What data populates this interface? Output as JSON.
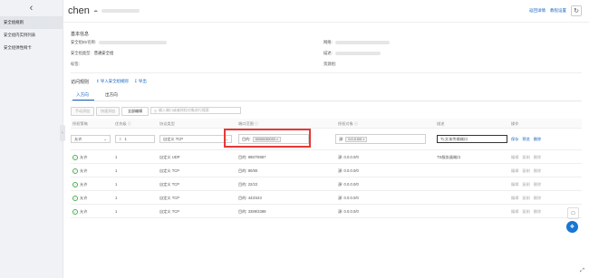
{
  "sidebar": {
    "back_icon": "chevron-left-icon",
    "items": [
      {
        "label": "安全组规则",
        "active": true
      },
      {
        "label": "安全组内实例列表",
        "active": false
      },
      {
        "label": "安全组弹性网卡",
        "active": false
      }
    ]
  },
  "header": {
    "title": "chen",
    "title_icon": "cloud-icon",
    "links": [
      "返回详情",
      "教程设置"
    ],
    "refresh_icon": "refresh-icon"
  },
  "basic": {
    "section_title": "基本信息",
    "labels": {
      "id": "安全组ID/名称:",
      "type": "安全组类型:",
      "tag": "标签:",
      "vpc": "网络:",
      "desc": "描述:",
      "resource_group": "资源组:"
    },
    "values": {
      "type": "普通安全组"
    }
  },
  "rules": {
    "section_title": "访问规则",
    "import_label": "导入安全组规则",
    "export_label": "导出",
    "tabs": [
      "入方向",
      "出方向"
    ],
    "buttons": [
      "手动添加",
      "快速添加",
      "全部编辑"
    ],
    "search_placeholder": "输入端口或者授权对象进行搜索"
  },
  "table": {
    "headers": [
      "授权策略",
      "优先级 ⓘ",
      "协议类型",
      "端口范围 ⓘ",
      "授权对象 ⓘ",
      "描述",
      "操作"
    ],
    "edit_row": {
      "policy": "允许",
      "priority": "1",
      "protocol": "自定义 TCP",
      "port_prefix": "目的:",
      "port_tag": "30000/30033",
      "source_prefix": "源:",
      "source_tag": "0.0.0.0/0",
      "description": "TL文本传输端口",
      "ops": [
        "保存",
        "预览",
        "删除"
      ]
    },
    "rows": [
      {
        "policy": "允许",
        "priority": "1",
        "protocol": "自定义 UDP",
        "port": "目的: 9987/9987",
        "source": "源: 0.0.0.0/0",
        "description": "TS服务器端口",
        "ops": [
          "编辑",
          "复制",
          "删除"
        ]
      },
      {
        "policy": "允许",
        "priority": "1",
        "protocol": "自定义 TCP",
        "port": "目的: 80/80",
        "source": "源: 0.0.0.0/0",
        "description": "",
        "ops": [
          "编辑",
          "复制",
          "删除"
        ]
      },
      {
        "policy": "允许",
        "priority": "1",
        "protocol": "自定义 TCP",
        "port": "目的: 22/22",
        "source": "源: 0.0.0.0/0",
        "description": "",
        "ops": [
          "编辑",
          "复制",
          "删除"
        ]
      },
      {
        "policy": "允许",
        "priority": "1",
        "protocol": "自定义 TCP",
        "port": "目的: 443/443",
        "source": "源: 0.0.0.0/0",
        "description": "",
        "ops": [
          "编辑",
          "复制",
          "删除"
        ]
      },
      {
        "policy": "允许",
        "priority": "1",
        "protocol": "自定义 TCP",
        "port": "目的: 3389/3389",
        "source": "源: 0.0.0.0/0",
        "description": "",
        "ops": [
          "编辑",
          "复制",
          "删除"
        ]
      }
    ]
  },
  "floating": {
    "chat_icon": "chat-icon",
    "help_icon": "help-icon",
    "resize_icon": "resize-icon"
  },
  "colors": {
    "accent": "#1565c0",
    "highlight": "#e53935",
    "success": "#4caf50"
  }
}
